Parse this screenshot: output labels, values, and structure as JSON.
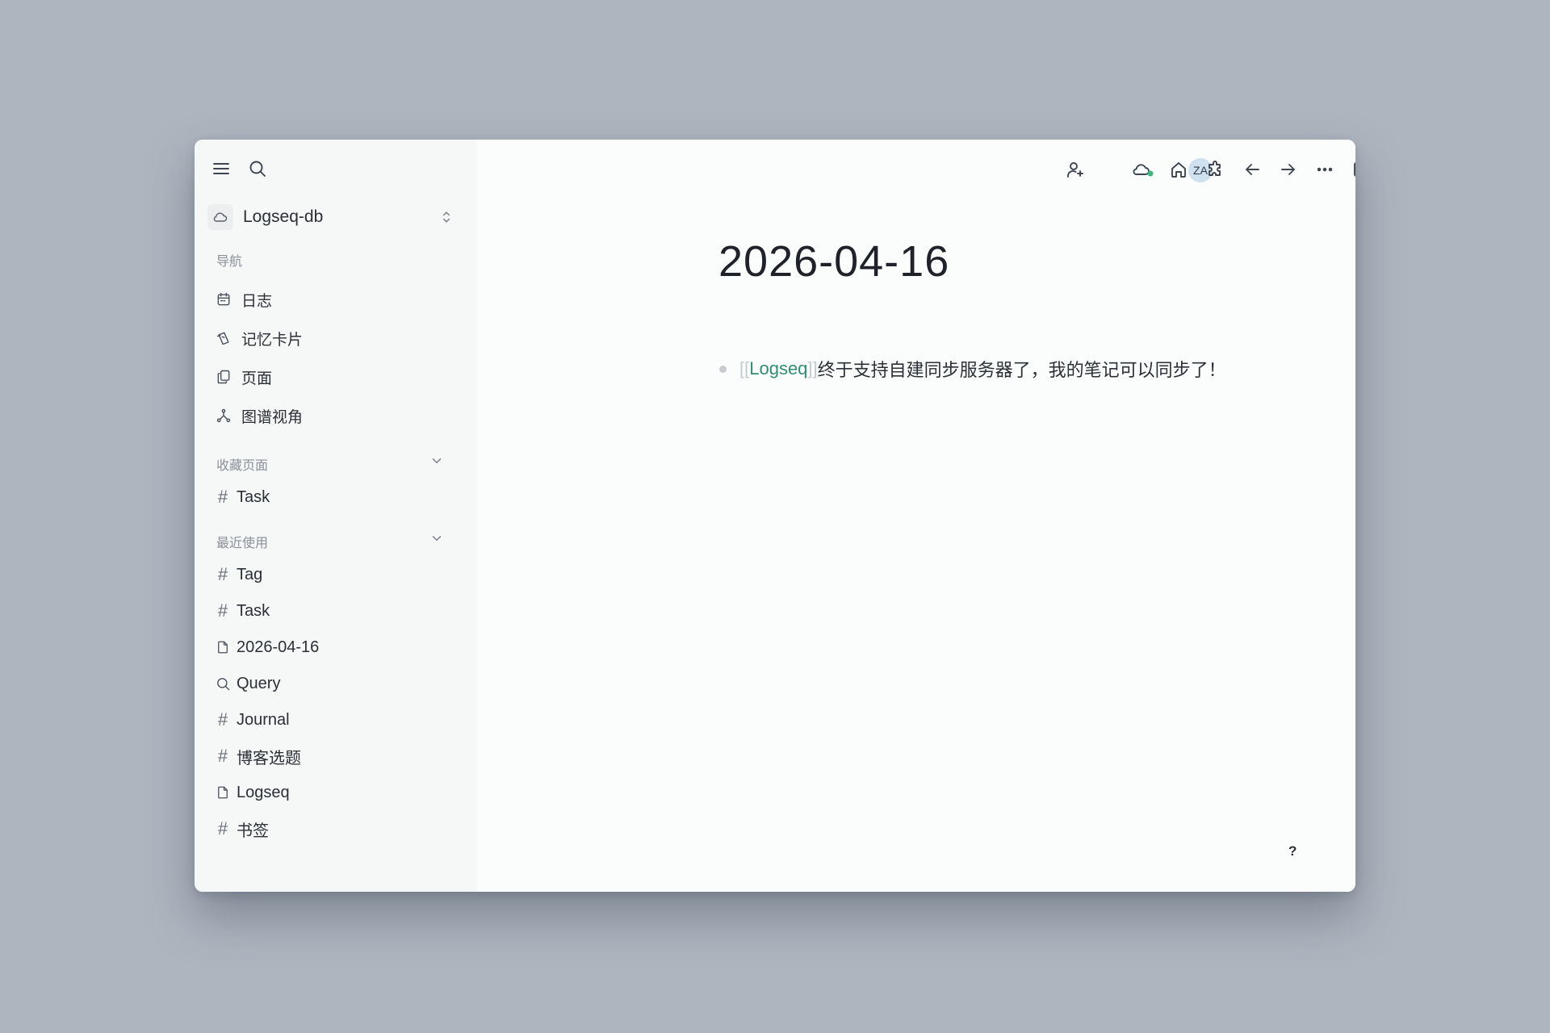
{
  "sidebar": {
    "graph_name": "Logseq-db",
    "nav_label": "导航",
    "nav_items": [
      {
        "label": "日志",
        "icon": "calendar-icon"
      },
      {
        "label": "记忆卡片",
        "icon": "flashcards-icon"
      },
      {
        "label": "页面",
        "icon": "pages-icon"
      },
      {
        "label": "图谱视角",
        "icon": "graph-icon"
      }
    ],
    "favorites_label": "收藏页面",
    "favorites": [
      {
        "label": "Task",
        "icon": "hash-icon"
      }
    ],
    "recent_label": "最近使用",
    "recent": [
      {
        "label": "Tag",
        "icon": "hash-icon"
      },
      {
        "label": "Task",
        "icon": "hash-icon"
      },
      {
        "label": "2026-04-16",
        "icon": "page-icon"
      },
      {
        "label": "Query",
        "icon": "search-icon"
      },
      {
        "label": "Journal",
        "icon": "hash-icon"
      },
      {
        "label": "博客选题",
        "icon": "hash-icon"
      },
      {
        "label": "Logseq",
        "icon": "page-icon"
      },
      {
        "label": "书签",
        "icon": "hash-icon"
      }
    ]
  },
  "toolbar": {
    "avatar_initials": "ZA",
    "sync_status_color": "#3fb37f"
  },
  "page": {
    "title": "2026-04-16",
    "blocks": [
      {
        "bracket_open": "[[",
        "ref": "Logseq",
        "bracket_close": "]]",
        "text": "终于支持自建同步服务器了，我的笔记可以同步了！"
      }
    ]
  },
  "help_label": "?"
}
